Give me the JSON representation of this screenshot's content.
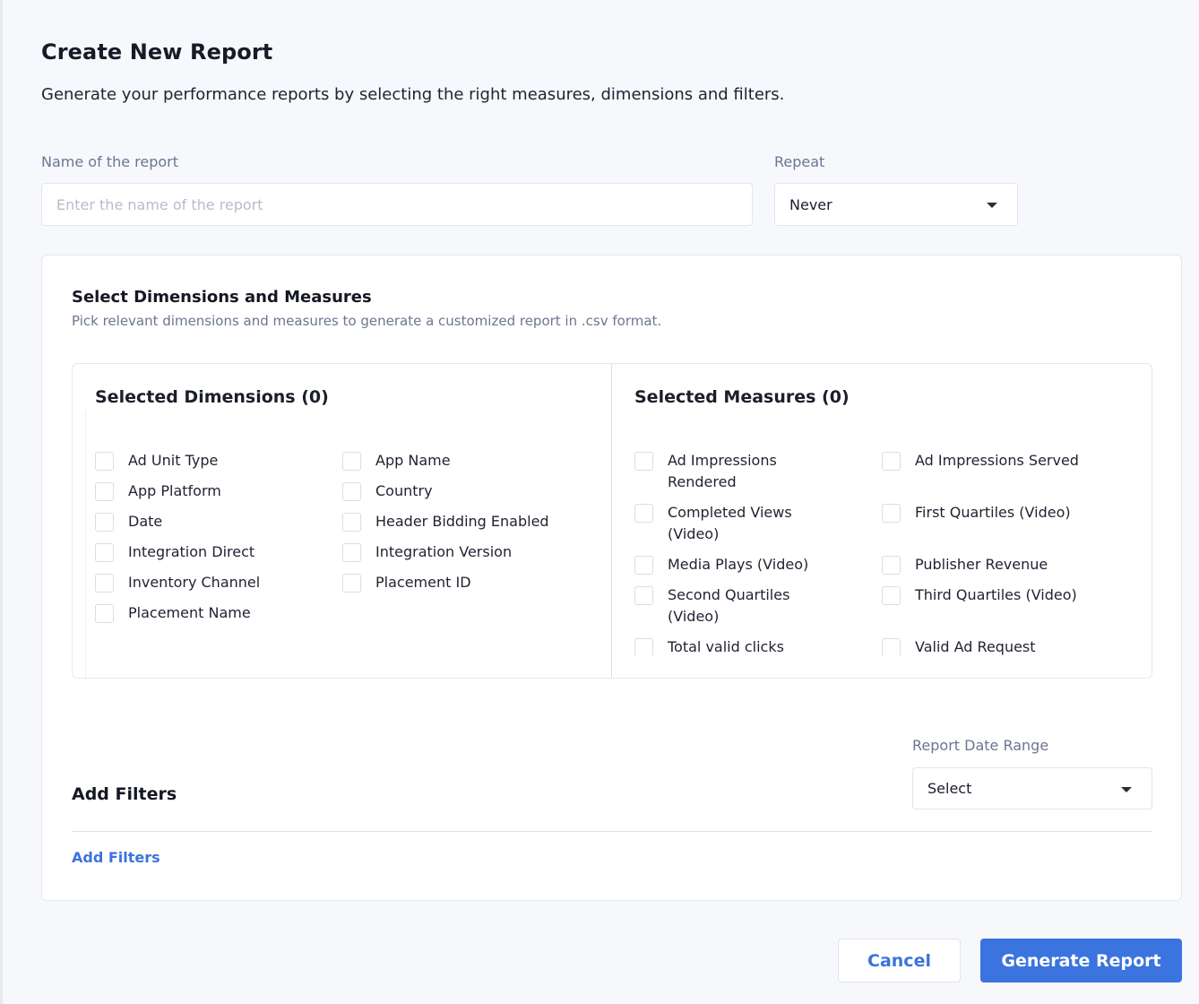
{
  "header": {
    "title": "Create New Report",
    "subtitle": "Generate your performance reports by selecting the right measures, dimensions and filters."
  },
  "form": {
    "name_label": "Name of the report",
    "name_placeholder": "Enter the name of the report",
    "name_value": "",
    "repeat_label": "Repeat",
    "repeat_value": "Never"
  },
  "card": {
    "title": "Select Dimensions and Measures",
    "subtitle": "Pick relevant dimensions and measures to generate a customized report in .csv format."
  },
  "dimensions": {
    "title": "Selected Dimensions (0)",
    "items": [
      "Ad Unit Type",
      "App Name",
      "App Platform",
      "Country",
      "Date",
      "Header Bidding Enabled",
      "Integration Direct",
      "Integration Version",
      "Inventory Channel",
      "Placement ID",
      "Placement Name"
    ]
  },
  "measures": {
    "title": "Selected Measures (0)",
    "items": [
      "Ad Impressions Rendered",
      "Ad Impressions Served",
      "Completed Views (Video)",
      "First Quartiles (Video)",
      "Media Plays (Video)",
      "Publisher Revenue",
      "Second Quartiles (Video)",
      "Third Quartiles (Video)",
      "Total valid clicks",
      "Valid Ad Request"
    ]
  },
  "filters": {
    "date_range_label": "Report Date Range",
    "date_range_value": "Select",
    "title": "Add Filters",
    "link": "Add Filters"
  },
  "actions": {
    "cancel": "Cancel",
    "generate": "Generate Report"
  },
  "colors": {
    "accent": "#3b74de",
    "background": "#f7f8fc",
    "muted_text": "#6b7691"
  }
}
